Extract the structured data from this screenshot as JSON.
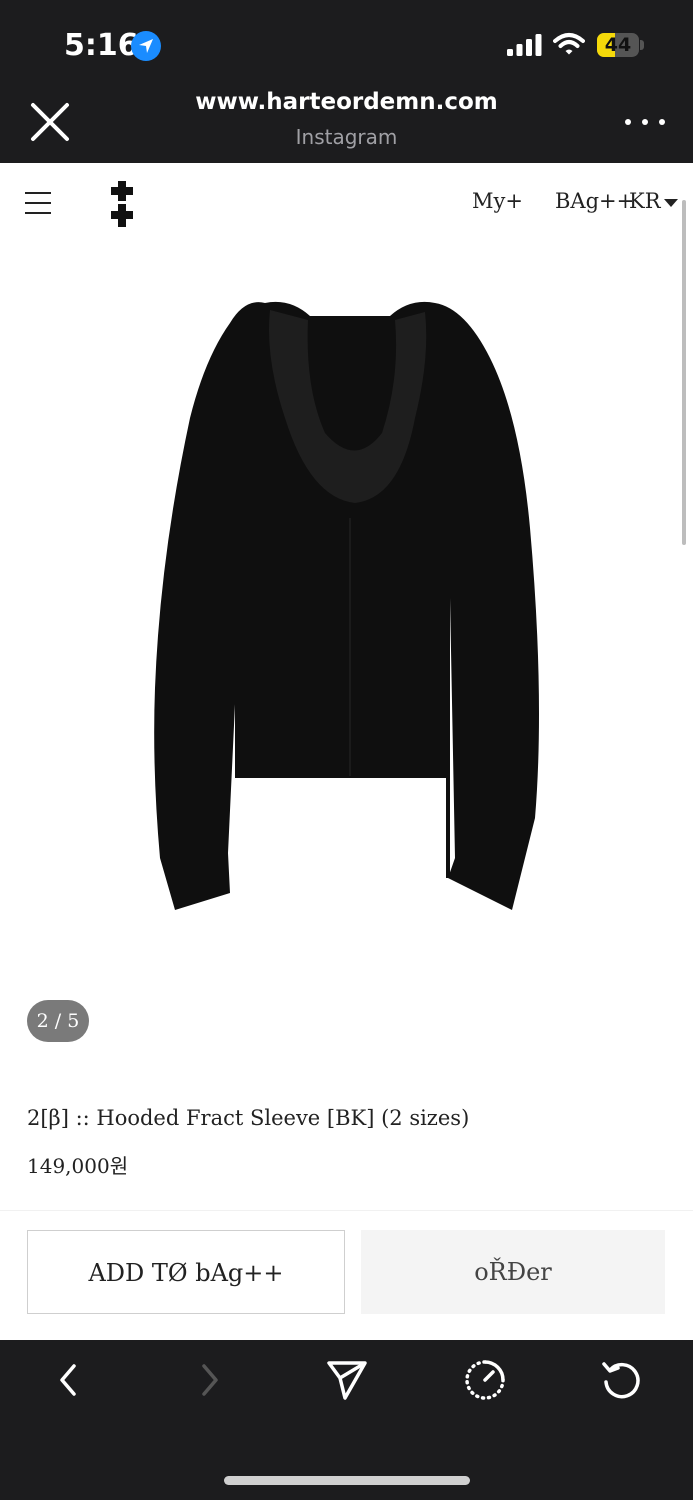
{
  "status_bar": {
    "time": "5:16",
    "battery": "44",
    "battery_level": 0.44
  },
  "browser": {
    "url": "www.harteordemn.com",
    "source": "Instagram"
  },
  "site_nav": {
    "my": "My+",
    "bag": "BAg++",
    "region": "KR"
  },
  "product": {
    "image_counter": "2 / 5",
    "name": "2[β] :: Hooded Fract Sleeve [BK] (2 sizes)",
    "price": "149,000원"
  },
  "actions": {
    "add_to_bag": "ADD TØ bAg++",
    "order": "oŘĐer"
  },
  "toolbar": {
    "items": [
      "back-icon",
      "forward-icon",
      "share-icon",
      "speed-icon",
      "refresh-icon"
    ]
  }
}
